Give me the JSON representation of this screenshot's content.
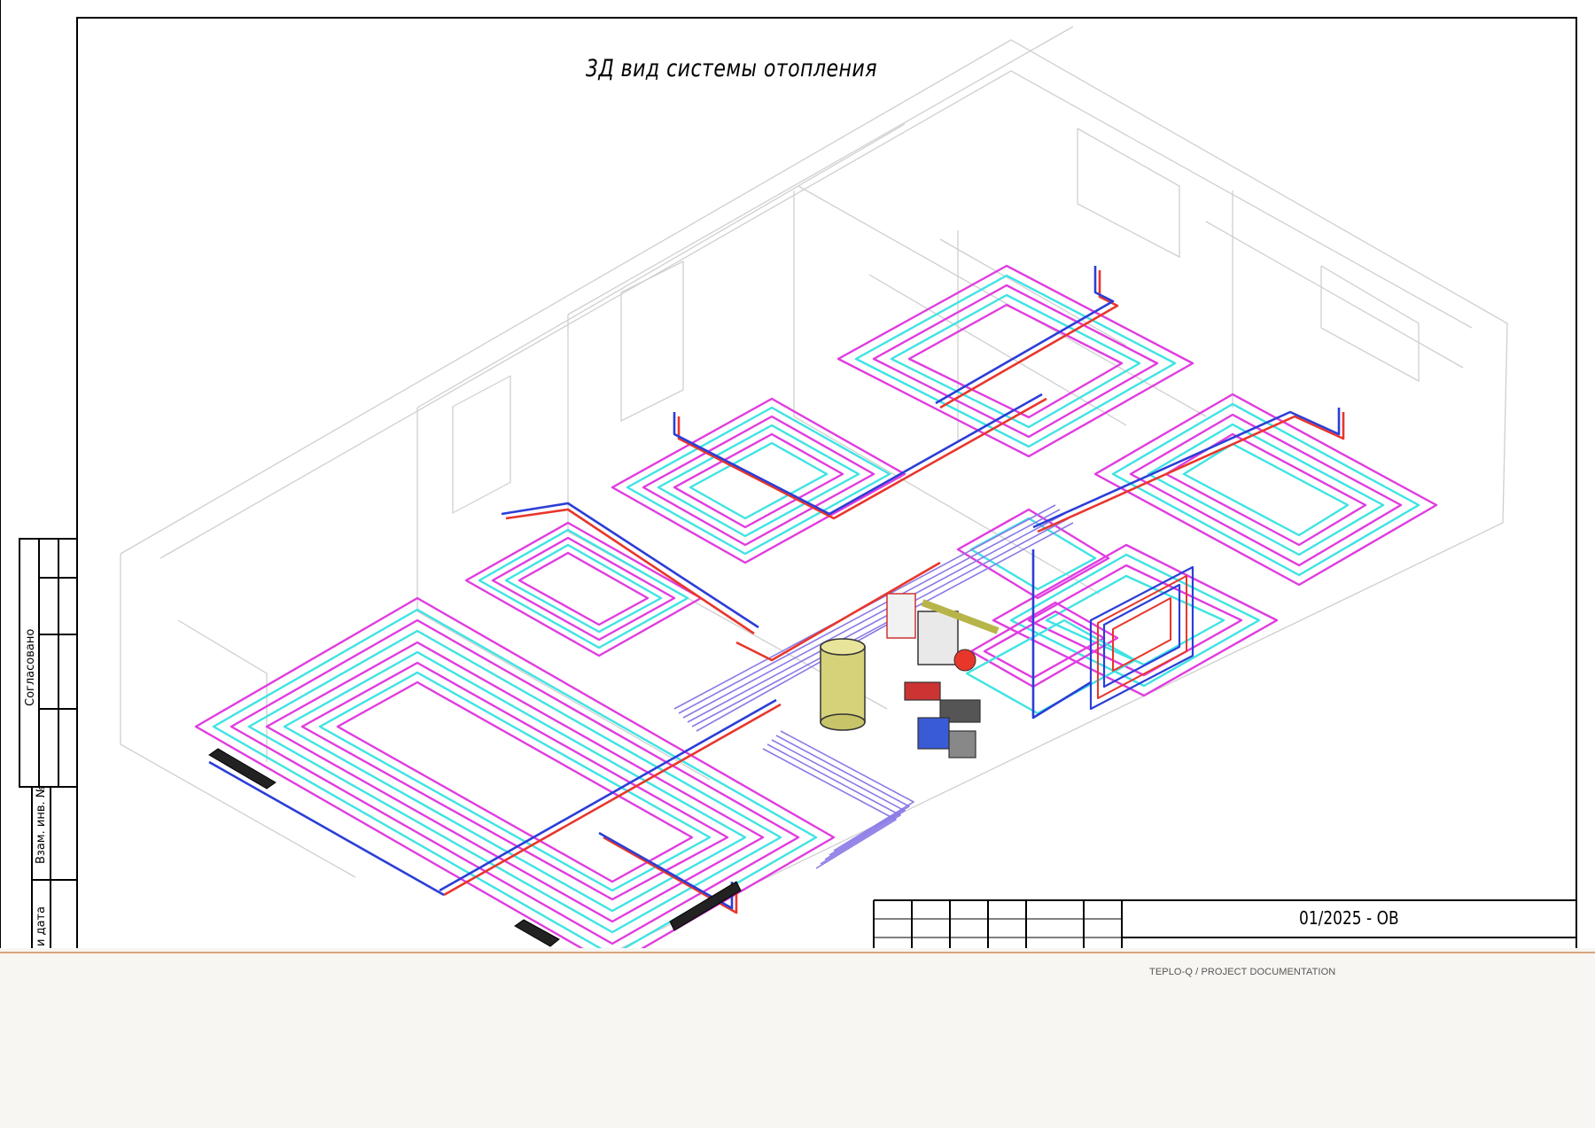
{
  "drawing": {
    "title": "3Д вид системы отопления",
    "document_code": "01/2025 - ОВ"
  },
  "stamp": {
    "agreed_label": "Согласовано",
    "replaced_inv_label": "Взам. инв. №",
    "date_label": "и дата"
  },
  "footer": {
    "caption": "TEPLO-Q / PROJECT DOCUMENTATION"
  },
  "colors": {
    "supply_pipe": "#e8362b",
    "return_pipe": "#2b3ed6",
    "loop_magenta": "#e03ce0",
    "loop_cyan": "#3fe3e3",
    "boiler_tank": "#d6d27a",
    "walls": "#c8c8c8"
  },
  "icons": {
    "boiler": "boiler-unit-icon",
    "tank": "buffer-tank-icon",
    "radiator": "radiator-icon"
  }
}
